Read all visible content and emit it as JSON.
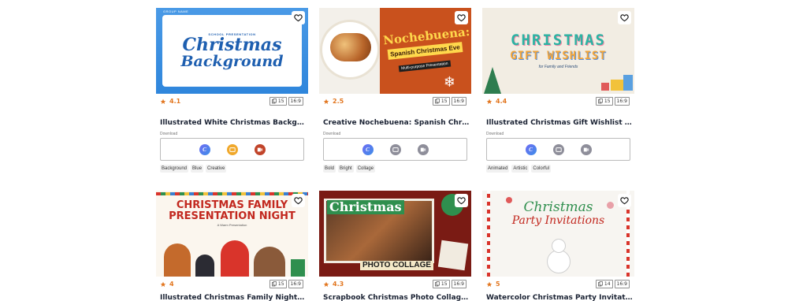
{
  "cards": [
    {
      "rating": "4.1",
      "slides": "15",
      "ratio": "16:9",
      "title": "Illustrated White Christmas Background Presentation",
      "download_label": "Download",
      "tags": [
        "Background",
        "Blue",
        "Creative"
      ],
      "thumb": {
        "top_left": "GROUP NAME",
        "kicker": "SCHOOL PRESENTATION",
        "line1": "Christmas",
        "line2": "Background",
        "bg": "#2f86dc",
        "fg": "#1e5fb0"
      }
    },
    {
      "rating": "2.5",
      "slides": "15",
      "ratio": "16:9",
      "title": "Creative Nochebuena: Spanish Christmas Eve",
      "download_label": "Download",
      "tags": [
        "Bold",
        "Bright",
        "Collage"
      ],
      "thumb": {
        "line1": "Nochebuena:",
        "line2": "Spanish Christmas Eve",
        "kicker": "Multi-purpose Presentation",
        "bg": "#c9511d"
      }
    },
    {
      "rating": "4.4",
      "slides": "15",
      "ratio": "16:9",
      "title": "Illustrated Christmas Gift Wishlist Presentation",
      "download_label": "Download",
      "tags": [
        "Animated",
        "Artistic",
        "Colorful"
      ],
      "thumb": {
        "line1": "CHRISTMAS",
        "line2": "GIFT WISHLIST",
        "kicker": "for Family and Friends",
        "bg": "#f2ede3"
      }
    },
    {
      "rating": "4",
      "slides": "15",
      "ratio": "16:9",
      "title": "Illustrated Christmas Family Night Slides",
      "thumb": {
        "line1": "CHRISTMAS FAMILY",
        "line2": "PRESENTATION NIGHT",
        "kicker": "A Warm Presentation",
        "bg": "#fbf6ee"
      }
    },
    {
      "rating": "4.3",
      "slides": "15",
      "ratio": "16:9",
      "title": "Scrapbook Christmas Photo Collage Slides",
      "thumb": {
        "line1": "Christmas",
        "line2": "PHOTO COLLAGE",
        "bg": "#7a1b14"
      }
    },
    {
      "rating": "5",
      "slides": "14",
      "ratio": "16:9",
      "title": "Watercolor Christmas Party Invitations",
      "thumb": {
        "line1": "Christmas",
        "line2": "Party Invitations",
        "bg": "#f7f5f1"
      }
    }
  ],
  "colors": {
    "rating": "#e2761f",
    "title": "#1a2233"
  },
  "icons": {
    "favorite": "heart-outline-icon",
    "rating": "star-icon",
    "slides": "copy-pages-icon",
    "canva": "canva-icon",
    "google_slides": "google-slides-icon",
    "powerpoint": "powerpoint-icon"
  }
}
